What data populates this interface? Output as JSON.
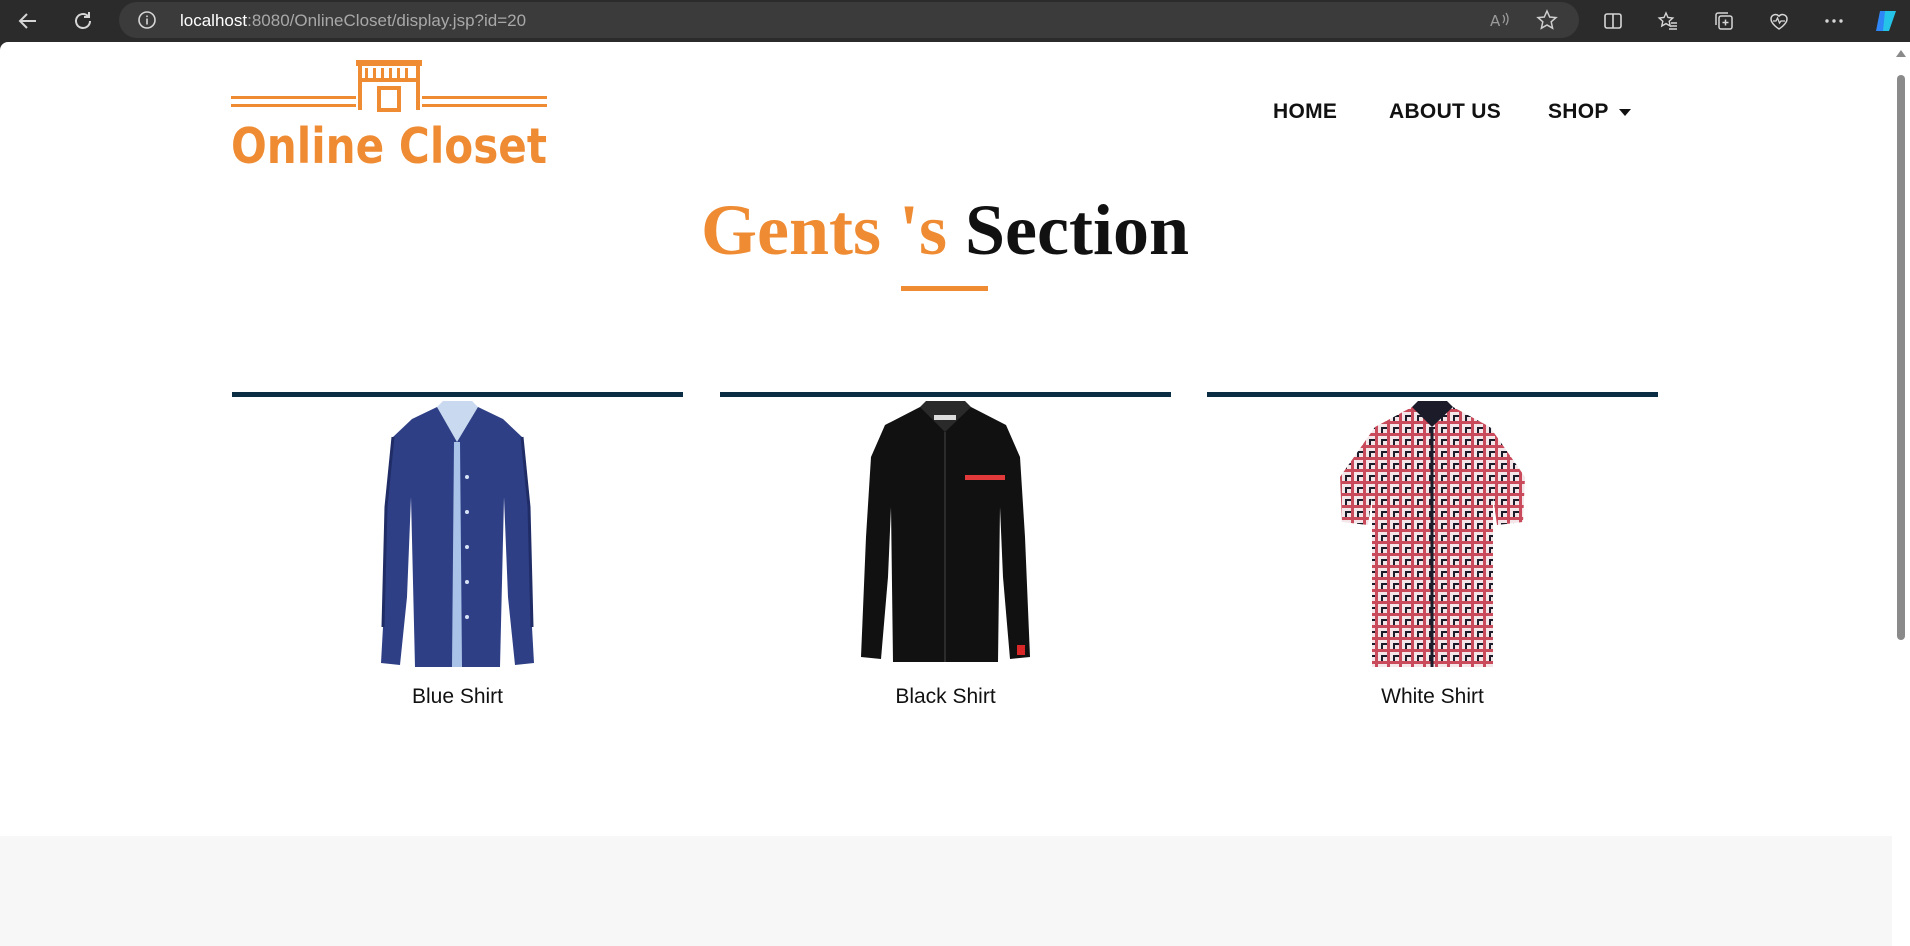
{
  "browser": {
    "url_host": "localhost",
    "url_rest": ":8080/OnlineCloset/display.jsp?id=20"
  },
  "site": {
    "logo_text": "Online Closet",
    "nav": {
      "home": "HOME",
      "about": "ABOUT US",
      "shop": "SHOP"
    }
  },
  "section": {
    "title_part1": "Gents 's",
    "title_part2": "Section"
  },
  "products": [
    {
      "name": "Blue Shirt",
      "color": "#2e3f86"
    },
    {
      "name": "Black Shirt",
      "color": "#111111"
    },
    {
      "name": "White Shirt",
      "color": "#c94a5a"
    }
  ],
  "colors": {
    "accent": "#ef8b32",
    "card_bar": "#0b2d44"
  }
}
